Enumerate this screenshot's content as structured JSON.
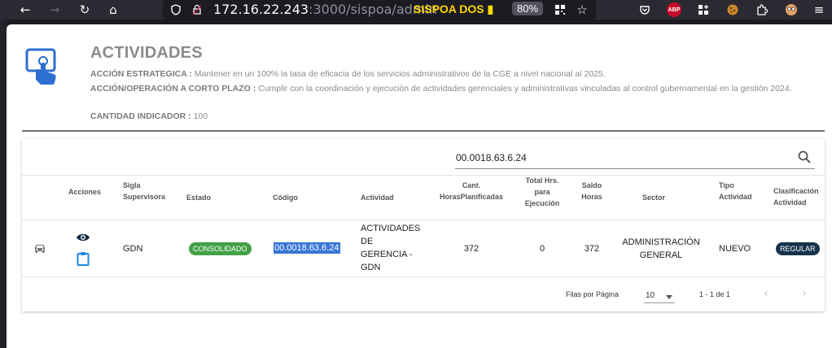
{
  "browser": {
    "url_host": "172.16.22.243",
    "url_rest": ":3000/sispoa/admin",
    "site_name": "SISPOA DOS",
    "zoom": "80%",
    "abp_label": "ABP"
  },
  "header": {
    "title": "ACTIVIDADES",
    "accion_estrategica_label": "ACCIÓN ESTRATEGICA :",
    "accion_estrategica_text": "Mantener en un 100% la tasa de eficacia de los servicios administrativos de la CGE a nivel nacional al 2025.",
    "accion_operacion_label": "ACCIÓN/OPERACIÓN A CORTO PLAZO :",
    "accion_operacion_text": "Cumplir con la coordinación y ejecución de actividades gerenciales y administrativas vinculadas al control gubernamental en la gestión 2024.",
    "cantidad_label": "CANTIDAD INDICADOR :",
    "cantidad_value": "100"
  },
  "search": {
    "value": "00.0018.63.6.24"
  },
  "table": {
    "headers": {
      "acciones": "Acciones",
      "sigla_1": "Sigla",
      "sigla_2": "Supervisora",
      "estado": "Estado",
      "codigo": "Código",
      "actividad": "Actividad",
      "cant_1": "Cant.",
      "cant_2": "HorasPlanificadas",
      "total_1": "Total Hrs.",
      "total_2": "para",
      "total_3": "Ejecución",
      "saldo_1": "Saldo",
      "saldo_2": "Horas",
      "sector": "Sector",
      "tipo_1": "Tipo",
      "tipo_2": "Actividad",
      "clasif_1": "Clasificación",
      "clasif_2": "Actividad"
    },
    "row": {
      "sigla": "GDN",
      "estado": "CONSOLIDADO",
      "codigo": "00.0018.63.6.24",
      "actividad_1": "ACTIVIDADES",
      "actividad_2": "DE",
      "actividad_3": "GERENCIA -",
      "actividad_4": "GDN",
      "cant_horas": "372",
      "total_hrs": "0",
      "saldo": "372",
      "sector_1": "ADMINISTRACIÓN",
      "sector_2": "GENERAL",
      "tipo": "NUEVO",
      "clasificacion": "REGULAR"
    }
  },
  "pagination": {
    "rows_label": "Filas por Página",
    "rows_value": "10",
    "range": "1 - 1 de 1"
  },
  "colors": {
    "estado_badge": "#43a047",
    "clasificacion_badge": "#17324c",
    "icon_blue": "#1e88e5",
    "selection": "#3876d6"
  }
}
